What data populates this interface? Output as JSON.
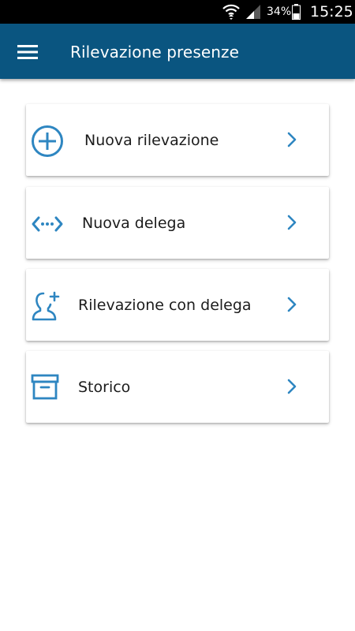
{
  "status_bar": {
    "battery_percent": "34%",
    "time": "15:25"
  },
  "app_bar": {
    "title": "Rilevazione presenze"
  },
  "menu": {
    "items": [
      {
        "label": "Nuova rilevazione",
        "icon": "add-circle-icon"
      },
      {
        "label": "Nuova delega",
        "icon": "delegate-arrows-icon"
      },
      {
        "label": "Rilevazione con delega",
        "icon": "person-add-icon"
      },
      {
        "label": "Storico",
        "icon": "archive-box-icon"
      }
    ]
  },
  "colors": {
    "app_bar": "#0a5580",
    "icon_accent": "#2e86c1",
    "background": "#ffffff",
    "status_bar": "#000000"
  }
}
